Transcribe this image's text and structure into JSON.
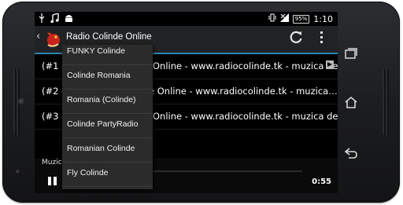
{
  "status_bar": {
    "left_icons": [
      "usb-icon",
      "music-icon",
      "android-icon"
    ],
    "battery": "95%",
    "time": "1:10"
  },
  "action_bar": {
    "title": "Radio Colinde Online",
    "icons": [
      "back-chevron-icon",
      "app-icon",
      "refresh-icon",
      "overflow-menu-icon"
    ]
  },
  "list": {
    "items": [
      {
        "num": "(#1 -",
        "text": "Online - www.radiocolinde.tk - muzica de…"
      },
      {
        "num": "(#2 -",
        "text": "e Online - www.radiocolinde.tk - muzica…"
      },
      {
        "num": "(#3 -",
        "text": "Online - www.radiocolinde.tk - muzica de…"
      }
    ]
  },
  "dropdown": {
    "items": [
      "FUNKY Colinde",
      "Colinde Romania",
      "Romania (Colinde)",
      "Colinde PartyRadio",
      "Romanian Colinde",
      "Fly Colinde"
    ]
  },
  "player": {
    "label": "Muzic",
    "time": "0:55"
  },
  "colors": {
    "accent": "#2e86b4",
    "actionbar_bg": "#202224",
    "dropdown_bg": "#2b2b2b"
  }
}
